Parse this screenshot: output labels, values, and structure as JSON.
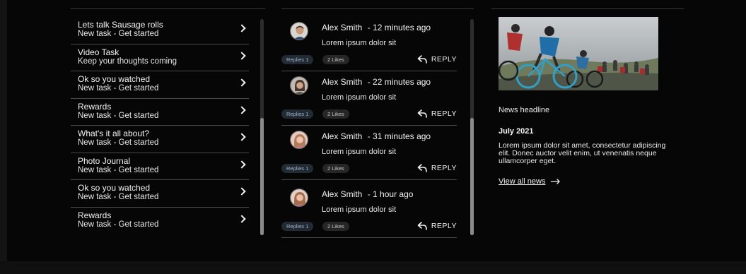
{
  "tasks": [
    {
      "title": "Lets talk Sausage rolls",
      "subtitle": "New task - Get started"
    },
    {
      "title": "Video Task",
      "subtitle": "Keep your thoughts coming"
    },
    {
      "title": "Ok so you watched",
      "subtitle": "New task - Get started"
    },
    {
      "title": "Rewards",
      "subtitle": "New task - Get started"
    },
    {
      "title": "What's it all about?",
      "subtitle": "New task - Get started"
    },
    {
      "title": "Photo Journal",
      "subtitle": "New task - Get started"
    },
    {
      "title": "Ok so you watched",
      "subtitle": "New task - Get started"
    },
    {
      "title": "Rewards",
      "subtitle": "New task - Get started"
    }
  ],
  "comments": [
    {
      "author": "Alex Smith",
      "time": "- 12 minutes ago",
      "body": "Lorem ipsum dolor sit",
      "replies": "Replies 1",
      "likes": "2 Likes",
      "reply_label": "REPLY"
    },
    {
      "author": "Alex Smith",
      "time": "- 22 minutes ago",
      "body": "Lorem ipsum dolor sit",
      "replies": "Replies 1",
      "likes": "2 Likes",
      "reply_label": "REPLY"
    },
    {
      "author": "Alex Smith",
      "time": "- 31 minutes ago",
      "body": "Lorem ipsum dolor sit",
      "replies": "Replies 1",
      "likes": "2 Likes",
      "reply_label": "REPLY"
    },
    {
      "author": "Alex Smith",
      "time": "- 1 hour ago",
      "body": "Lorem ipsum dolor sit",
      "replies": "Replies 1",
      "likes": "2 Likes",
      "reply_label": "REPLY"
    }
  ],
  "news": {
    "headline": "News headline",
    "date": "July 2021",
    "body": "Lorem ipsum dolor sit amet, consectetur adipiscing elit. Donec auctor velit enim, ut venenatis neque ullamcorper eget.",
    "link_label": "View all news"
  },
  "colors": {
    "background": "#060606",
    "divider": "#4a4a4a",
    "replies_pill": "#222a33",
    "likes_pill": "#262626"
  }
}
